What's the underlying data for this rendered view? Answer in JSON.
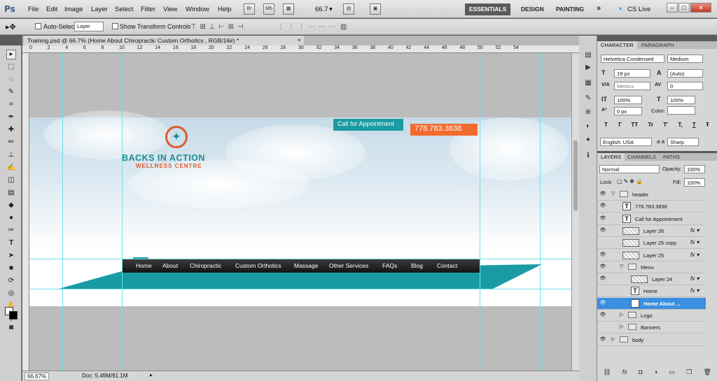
{
  "app": {
    "logo": "Ps"
  },
  "menus": [
    "File",
    "Edit",
    "Image",
    "Layer",
    "Select",
    "Filter",
    "View",
    "Window",
    "Help"
  ],
  "appbar": {
    "bridge": "Br",
    "minibridge": "Mb",
    "zoom": "66.7"
  },
  "workspaces": [
    "ESSENTIALS",
    "DESIGN",
    "PAINTING"
  ],
  "overflow": "»",
  "cslive": "CS Live",
  "options": {
    "auto_select_label": "Auto-Select:",
    "auto_select_value": "Layer",
    "transform_label": "Show Transform Controls"
  },
  "document_tab": {
    "title": "Training.psd @ 66.7% (Home      About      Chiropractic      Custom Orthotics      , RGB/16#) *"
  },
  "ruler_h": [
    "0",
    "2",
    "4",
    "6",
    "8",
    "10",
    "12",
    "14",
    "16",
    "18",
    "20",
    "22",
    "24",
    "26",
    "28",
    "30",
    "32",
    "34",
    "36",
    "38",
    "40",
    "42",
    "44",
    "46",
    "48",
    "50",
    "52",
    "54"
  ],
  "design": {
    "call_label": "Call for Appointment",
    "phone": "778.783.3838",
    "logo_title": "BACKS IN ACTION",
    "logo_sub": "WELLNESS CENTRE",
    "nav": [
      "Home",
      "About",
      "Chiropractic",
      "Custom Orthotics",
      "Massage",
      "Other Services",
      "FAQs",
      "Blog",
      "Contact"
    ]
  },
  "status": {
    "zoom": "66.67%",
    "doc": "Doc: 5.49M/91.1M"
  },
  "character": {
    "tabs": [
      "CHARACTER",
      "PARAGRAPH"
    ],
    "font_family": "Helvetica Condensed",
    "font_style": "Medium",
    "size": "19 px",
    "leading": "(Auto)",
    "kerning": "Metrics",
    "tracking": "0",
    "vscale": "100%",
    "hscale": "100%",
    "baseline": "0 px",
    "color_label": "Color:",
    "language": "English: USA",
    "aa_label": "a a",
    "antialias": "Sharp",
    "styles": [
      "T",
      "T",
      "TT",
      "Tr",
      "T'",
      "T,",
      "T",
      "Ŧ"
    ]
  },
  "layers": {
    "tabs": [
      "LAYERS",
      "CHANNELS",
      "PATHS"
    ],
    "blend": "Normal",
    "opacity_label": "Opacity:",
    "opacity": "100%",
    "lock_label": "Lock:",
    "fill_label": "Fill:",
    "fill": "100%",
    "rows": [
      {
        "name": "header",
        "kind": "folder",
        "visible": true,
        "indent": 0,
        "open": true
      },
      {
        "name": "778.783.3838",
        "kind": "text",
        "visible": true,
        "indent": 1
      },
      {
        "name": "Call for Appointment",
        "kind": "text",
        "visible": true,
        "indent": 1
      },
      {
        "name": "Layer 26",
        "kind": "image",
        "visible": true,
        "indent": 1,
        "fx": true
      },
      {
        "name": "Layer 25 copy",
        "kind": "image",
        "visible": false,
        "indent": 1,
        "fx": true
      },
      {
        "name": "Layer 25",
        "kind": "image",
        "visible": true,
        "indent": 1,
        "fx": true
      },
      {
        "name": "Menu",
        "kind": "folder",
        "visible": true,
        "indent": 1,
        "open": true
      },
      {
        "name": "Layer 24",
        "kind": "image",
        "visible": true,
        "indent": 2,
        "fx": true
      },
      {
        "name": "Home",
        "kind": "text",
        "visible": false,
        "indent": 2,
        "fx": true
      },
      {
        "name": "Home      About      ...",
        "kind": "text",
        "visible": true,
        "indent": 2,
        "selected": true
      },
      {
        "name": "Logo",
        "kind": "folder",
        "visible": true,
        "indent": 1,
        "open": false
      },
      {
        "name": "Banners",
        "kind": "folder",
        "visible": false,
        "indent": 1,
        "open": false
      },
      {
        "name": "body",
        "kind": "folder",
        "visible": true,
        "indent": 0,
        "open": false
      }
    ],
    "bottom_icons": [
      "link-icon",
      "fx-icon",
      "mask-icon",
      "adjustment-icon",
      "group-icon",
      "new-layer-icon",
      "trash-icon"
    ]
  }
}
